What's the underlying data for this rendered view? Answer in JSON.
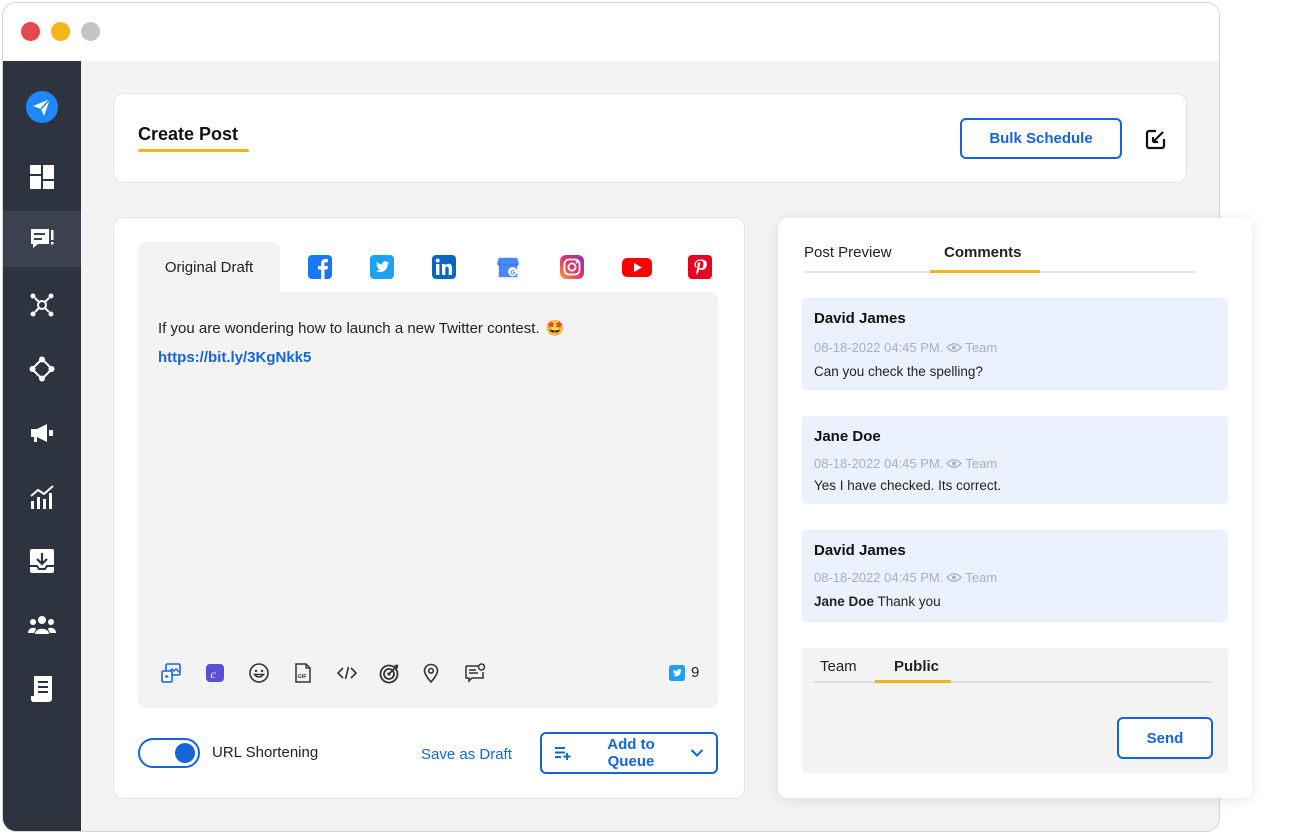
{
  "colors": {
    "accent": "#1565d8",
    "sidebar": "#2d3440",
    "underline": "#f5b41a",
    "comment_bg": "#ebf1fd"
  },
  "sidebar": {
    "icons": [
      "send-logo-icon",
      "dashboard-icon",
      "compose-icon",
      "network-icon",
      "connect-icon",
      "megaphone-icon",
      "analytics-icon",
      "inbox-download-icon",
      "team-icon",
      "report-icon"
    ],
    "active_index": 2
  },
  "header": {
    "title": "Create Post",
    "bulk_schedule_label": "Bulk Schedule"
  },
  "composer": {
    "original_tab_label": "Original Draft",
    "networks": [
      "facebook-icon",
      "twitter-icon",
      "linkedin-icon",
      "google-business-icon",
      "instagram-icon",
      "youtube-icon",
      "pinterest-icon"
    ],
    "post_text": "If you are wondering how to launch a new Twitter contest.",
    "emoji": "🤩",
    "post_link": "https://bit.ly/3KgNkk5",
    "tools": [
      "media-icon",
      "canva-icon",
      "emoji-icon",
      "gif-icon",
      "embed-code-icon",
      "target-icon",
      "location-icon",
      "comment-note-icon"
    ],
    "char_count": "9",
    "url_shortening_label": "URL Shortening",
    "url_shortening_on": true,
    "save_draft_label": "Save as Draft",
    "add_to_queue_label": "Add to Queue"
  },
  "preview": {
    "tabs": [
      "Post Preview",
      "Comments"
    ],
    "active_tab": "Comments",
    "comments": [
      {
        "author": "David James",
        "timestamp": "08-18-2022 04:45 PM.",
        "visibility": "Team",
        "text": "Can you check the spelling?"
      },
      {
        "author": "Jane Doe",
        "timestamp": "08-18-2022 04:45 PM.",
        "visibility": "Team",
        "text": "Yes I have checked. Its correct."
      },
      {
        "author": "David James",
        "timestamp": "08-18-2022 04:45 PM.",
        "visibility": "Team",
        "mention": "Jane Doe",
        "text": "Thank you"
      }
    ],
    "reply_tabs": [
      "Team",
      "Public"
    ],
    "reply_active_tab": "Public",
    "send_label": "Send"
  }
}
